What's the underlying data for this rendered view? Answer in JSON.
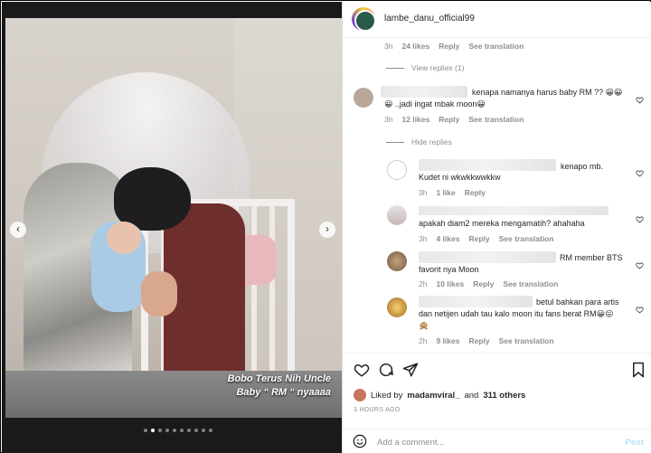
{
  "post": {
    "username": "lambe_danu_official99",
    "caption_overlay": [
      "Bobo Terus Nih Uncle",
      "Baby “ RM “ nyaaaa"
    ],
    "slides_count": 10,
    "active_slide": 1
  },
  "comments": [
    {
      "id": "c0",
      "meta": {
        "time": "3h",
        "likes": "24 likes",
        "reply": "Reply",
        "translate": "See translation"
      },
      "toggle": "View replies (1)"
    },
    {
      "id": "c1",
      "text_line1": "kenapa namanya harus baby RM ?? 😀😀",
      "text_line2": "😀 ..jadi ingat mbak moon😀",
      "meta": {
        "time": "3h",
        "likes": "12 likes",
        "reply": "Reply",
        "translate": "See translation"
      },
      "toggle": "Hide replies"
    },
    {
      "id": "r1",
      "text_line1": "kenapo mb.",
      "text_line2": "Kudet ni wkwkkwwkkw",
      "meta": {
        "time": "3h",
        "likes": "1 like",
        "reply": "Reply"
      }
    },
    {
      "id": "r2",
      "text_line1": "apakah diam2 mereka mengamatih? ahahaha",
      "meta": {
        "time": "3h",
        "likes": "4 likes",
        "reply": "Reply",
        "translate": "See translation"
      }
    },
    {
      "id": "r3",
      "text_line1": "RM member BTS",
      "text_line2": "favorit nya Moon",
      "meta": {
        "time": "2h",
        "likes": "10 likes",
        "reply": "Reply",
        "translate": "See translation"
      }
    },
    {
      "id": "r4",
      "text_line1": "betul bahkan para artis",
      "text_line2": "dan netijen udah tau kalo moon itu fans berat RM😀😛",
      "text_line3": "🙊",
      "meta": {
        "time": "2h",
        "likes": "9 likes",
        "reply": "Reply",
        "translate": "See translation"
      }
    }
  ],
  "footer": {
    "liked_by_prefix": "Liked by",
    "liked_by_user": "madamviral_",
    "liked_by_suffix": "and",
    "liked_by_others": "311 others",
    "timestamp": "3 HOURS AGO",
    "add_comment_placeholder": "Add a comment...",
    "post_label": "Post"
  },
  "icons": {
    "like": "heart-icon",
    "comment": "comment-icon",
    "share": "share-icon",
    "save": "bookmark-icon",
    "emoji": "smiley-icon",
    "prev": "chevron-left-icon",
    "next": "chevron-right-icon"
  }
}
